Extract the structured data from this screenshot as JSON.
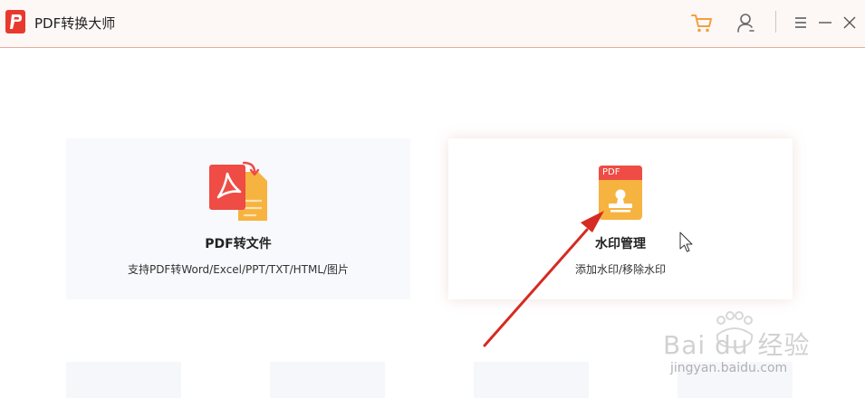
{
  "window": {
    "title": "PDF转换大师",
    "icons": [
      "cart-icon",
      "user-icon",
      "menu-icon",
      "minimize-icon",
      "close-icon"
    ]
  },
  "cards": [
    {
      "title": "PDF转文件",
      "subtitle": "支持PDF转Word/Excel/PPT/TXT/HTML/图片"
    },
    {
      "title": "水印管理",
      "subtitle": "添加水印/移除水印",
      "icon_text": "PDF"
    }
  ],
  "watermark": {
    "text": "Bai du 经验",
    "url": "jingyan.baidu.com"
  },
  "colors": {
    "accent": "#e8392f",
    "cart": "#f2a03d",
    "arrow": "#d62a22"
  }
}
